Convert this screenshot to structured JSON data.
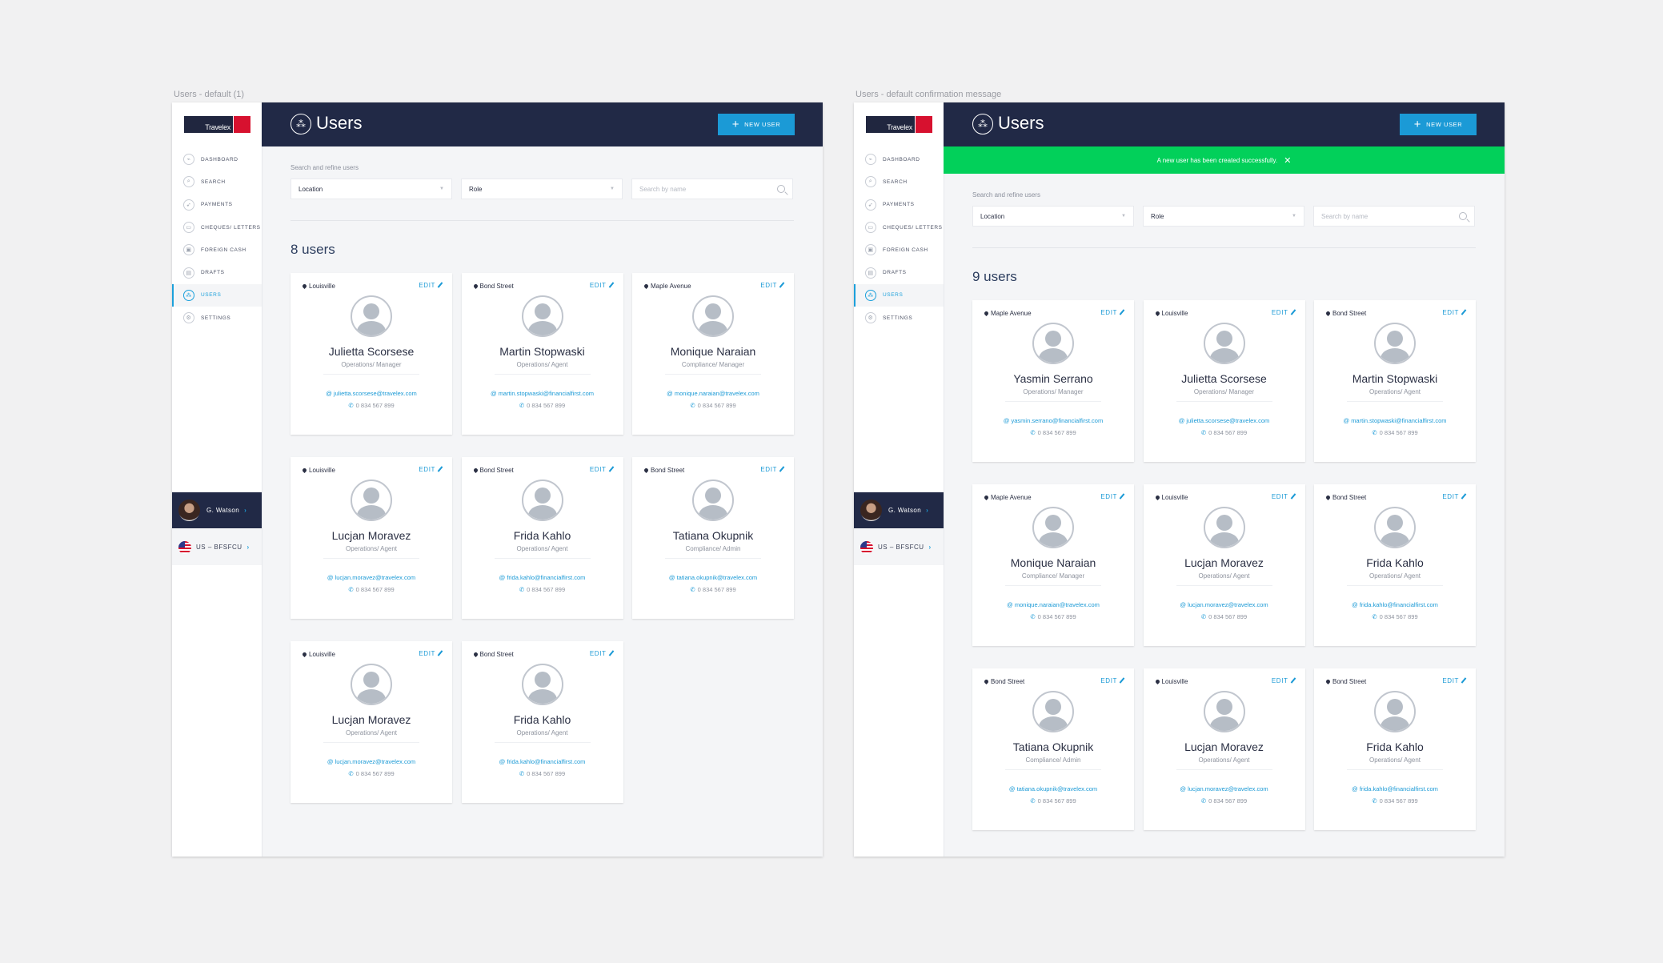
{
  "frames": [
    {
      "label": "Users - default (1)",
      "brand": "Travelex",
      "nav": [
        {
          "label": "DASHBOARD",
          "icon": "pulse-icon",
          "glyph": "⌁"
        },
        {
          "label": "SEARCH",
          "icon": "search-icon",
          "glyph": "⌕"
        },
        {
          "label": "PAYMENTS",
          "icon": "paper-plane-icon",
          "glyph": "➶"
        },
        {
          "label": "CHEQUES/ LETTERS",
          "icon": "cheque-icon",
          "glyph": "▭"
        },
        {
          "label": "FOREIGN CASH",
          "icon": "cash-icon",
          "glyph": "▣"
        },
        {
          "label": "DRAFTS",
          "icon": "drafts-icon",
          "glyph": "▤"
        },
        {
          "label": "USERS",
          "icon": "users-icon",
          "glyph": "⁂",
          "active": true
        },
        {
          "label": "SETTINGS",
          "icon": "gear-icon",
          "glyph": "⚙"
        }
      ],
      "user_name": "G. Watson",
      "country": "US – BFSFCU",
      "page_title": "Users",
      "new_user_label": "NEW USER",
      "filter_label": "Search and refine users",
      "location_select": "Location",
      "role_select": "Role",
      "search_placeholder": "Search by name",
      "count_label": "8 users",
      "users": [
        {
          "location": "Louisville",
          "name": "Julietta Scorsese",
          "role": "Operations/ Manager",
          "email": "julietta.scorsese@travelex.com",
          "phone": "0 834 567 899"
        },
        {
          "location": "Bond Street",
          "name": "Martin Stopwaski",
          "role": "Operations/ Agent",
          "email": "martin.stopwaski@financialfirst.com",
          "phone": "0 834 567 899"
        },
        {
          "location": "Maple Avenue",
          "name": "Monique Naraian",
          "role": "Compliance/ Manager",
          "email": "monique.naraian@travelex.com",
          "phone": "0 834 567 899"
        },
        {
          "location": "Louisville",
          "name": "Lucjan Moravez",
          "role": "Operations/ Agent",
          "email": "lucjan.moravez@travelex.com",
          "phone": "0 834 567 899"
        },
        {
          "location": "Bond Street",
          "name": "Frida Kahlo",
          "role": "Operations/ Agent",
          "email": "frida.kahlo@financialfirst.com",
          "phone": "0 834 567 899"
        },
        {
          "location": "Bond Street",
          "name": "Tatiana Okupnik",
          "role": "Compliance/ Admin",
          "email": "tatiana.okupnik@travelex.com",
          "phone": "0 834 567 899"
        },
        {
          "location": "Louisville",
          "name": "Lucjan Moravez",
          "role": "Operations/ Agent",
          "email": "lucjan.moravez@travelex.com",
          "phone": "0 834 567 899"
        },
        {
          "location": "Bond Street",
          "name": "Frida Kahlo",
          "role": "Operations/ Agent",
          "email": "frida.kahlo@financialfirst.com",
          "phone": "0 834 567 899"
        }
      ]
    },
    {
      "label": "Users - default confirmation message",
      "brand": "Travelex",
      "nav": [
        {
          "label": "DASHBOARD",
          "icon": "pulse-icon",
          "glyph": "⌁"
        },
        {
          "label": "SEARCH",
          "icon": "search-icon",
          "glyph": "⌕"
        },
        {
          "label": "PAYMENTS",
          "icon": "paper-plane-icon",
          "glyph": "➶"
        },
        {
          "label": "CHEQUES/ LETTERS",
          "icon": "cheque-icon",
          "glyph": "▭"
        },
        {
          "label": "FOREIGN CASH",
          "icon": "cash-icon",
          "glyph": "▣"
        },
        {
          "label": "DRAFTS",
          "icon": "drafts-icon",
          "glyph": "▤"
        },
        {
          "label": "USERS",
          "icon": "users-icon",
          "glyph": "⁂",
          "active": true
        },
        {
          "label": "SETTINGS",
          "icon": "gear-icon",
          "glyph": "⚙"
        }
      ],
      "user_name": "G. Watson",
      "country": "US – BFSFCU",
      "page_title": "Users",
      "new_user_label": "NEW USER",
      "banner_message": "A new user has been created successfully.",
      "filter_label": "Search and refine users",
      "location_select": "Location",
      "role_select": "Role",
      "search_placeholder": "Search by name",
      "count_label": "9 users",
      "users": [
        {
          "location": "Maple Avenue",
          "name": "Yasmin Serrano",
          "role": "Operations/ Manager",
          "email": "yasmin.serrano@financialfirst.com",
          "phone": "0 834 567 899"
        },
        {
          "location": "Louisville",
          "name": "Julietta Scorsese",
          "role": "Operations/ Manager",
          "email": "julietta.scorsese@travelex.com",
          "phone": "0 834 567 899"
        },
        {
          "location": "Bond Street",
          "name": "Martin Stopwaski",
          "role": "Operations/ Agent",
          "email": "martin.stopwaski@financialfirst.com",
          "phone": "0 834 567 899"
        },
        {
          "location": "Maple Avenue",
          "name": "Monique Naraian",
          "role": "Compliance/ Manager",
          "email": "monique.naraian@travelex.com",
          "phone": "0 834 567 899"
        },
        {
          "location": "Louisville",
          "name": "Lucjan Moravez",
          "role": "Operations/ Agent",
          "email": "lucjan.moravez@travelex.com",
          "phone": "0 834 567 899"
        },
        {
          "location": "Bond Street",
          "name": "Frida Kahlo",
          "role": "Operations/ Agent",
          "email": "frida.kahlo@financialfirst.com",
          "phone": "0 834 567 899"
        },
        {
          "location": "Bond Street",
          "name": "Tatiana Okupnik",
          "role": "Compliance/ Admin",
          "email": "tatiana.okupnik@travelex.com",
          "phone": "0 834 567 899"
        },
        {
          "location": "Louisville",
          "name": "Lucjan Moravez",
          "role": "Operations/ Agent",
          "email": "lucjan.moravez@travelex.com",
          "phone": "0 834 567 899"
        },
        {
          "location": "Bond Street",
          "name": "Frida Kahlo",
          "role": "Operations/ Agent",
          "email": "frida.kahlo@financialfirst.com",
          "phone": "0 834 567 899"
        }
      ]
    }
  ],
  "labels": {
    "edit": "EDIT",
    "at": "@",
    "phone_glyph": "✆",
    "plus": "+",
    "close": "✕",
    "caret": "▼",
    "chevron": "›",
    "users_glyph": "⁂"
  },
  "colors": {
    "navy": "#212946",
    "accent": "#1b9ad6",
    "success": "#02d05a",
    "brand_red": "#d7112f"
  }
}
